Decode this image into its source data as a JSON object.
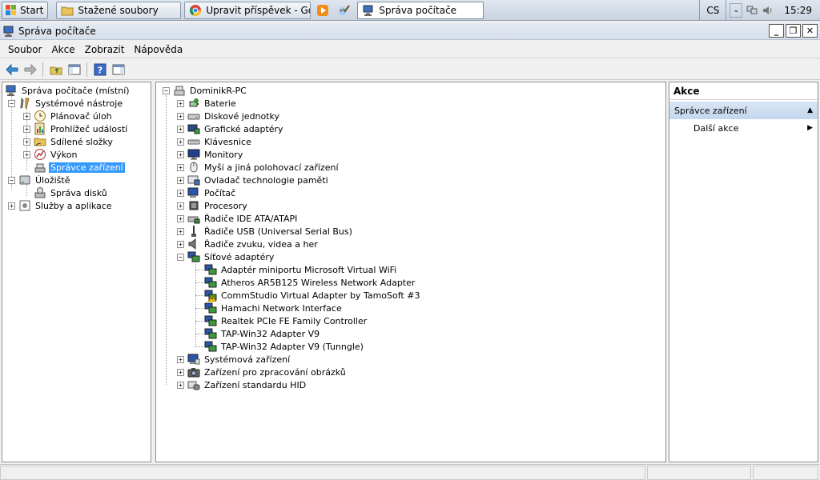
{
  "taskbar": {
    "start_label": "Start",
    "buttons": [
      {
        "label": "Stažené soubory",
        "icon": "folder-icon"
      },
      {
        "label": "Upravit příspěvek - Goo...",
        "icon": "chrome-icon"
      },
      {
        "label": "Správa počítače",
        "icon": "computer-management-icon"
      }
    ],
    "language": "CS",
    "clock": "15:29"
  },
  "window": {
    "title": "Správa počítače",
    "controls": {
      "minimize": "_",
      "restore": "❐",
      "close": "✕"
    }
  },
  "menu": [
    "Soubor",
    "Akce",
    "Zobrazit",
    "Nápověda"
  ],
  "left_tree": [
    {
      "label": "Správa počítače (místní)",
      "icon": "computer-management-icon"
    },
    {
      "label": "Systémové nástroje",
      "icon": "tools-icon",
      "expander": "−"
    },
    {
      "label": "Plánovač úloh",
      "icon": "clock-icon",
      "expander": "+"
    },
    {
      "label": "Prohlížeč událostí",
      "icon": "event-viewer-icon",
      "expander": "+"
    },
    {
      "label": "Sdílené složky",
      "icon": "shared-folder-icon",
      "expander": "+"
    },
    {
      "label": "Výkon",
      "icon": "performance-icon",
      "expander": "+"
    },
    {
      "label": "Správce zařízení",
      "icon": "device-manager-icon",
      "selected": true
    },
    {
      "label": "Úložiště",
      "icon": "storage-icon",
      "expander": "−"
    },
    {
      "label": "Správa disků",
      "icon": "disk-management-icon"
    },
    {
      "label": "Služby a aplikace",
      "icon": "services-icon",
      "expander": "+"
    }
  ],
  "device_tree": {
    "root": "DominikR-PC",
    "root_expander": "−",
    "categories": [
      {
        "label": "Baterie",
        "icon": "battery-icon",
        "expander": "+"
      },
      {
        "label": "Diskové jednotky",
        "icon": "disk-drive-icon",
        "expander": "+"
      },
      {
        "label": "Grafické adaptéry",
        "icon": "display-adapter-icon",
        "expander": "+"
      },
      {
        "label": "Klávesnice",
        "icon": "keyboard-icon",
        "expander": "+"
      },
      {
        "label": "Monitory",
        "icon": "monitor-icon",
        "expander": "+"
      },
      {
        "label": "Myši a jiná polohovací zařízení",
        "icon": "mouse-icon",
        "expander": "+"
      },
      {
        "label": "Ovladač technologie paměti",
        "icon": "memory-controller-icon",
        "expander": "+"
      },
      {
        "label": "Počítač",
        "icon": "computer-icon",
        "expander": "+"
      },
      {
        "label": "Procesory",
        "icon": "processor-icon",
        "expander": "+"
      },
      {
        "label": "Řadiče IDE ATA/ATAPI",
        "icon": "ide-controller-icon",
        "expander": "+"
      },
      {
        "label": "Řadiče USB (Universal Serial Bus)",
        "icon": "usb-icon",
        "expander": "+"
      },
      {
        "label": "Řadiče zvuku, videa a her",
        "icon": "speaker-icon",
        "expander": "+"
      },
      {
        "label": "Síťové adaptéry",
        "icon": "network-adapter-icon",
        "expander": "−"
      }
    ],
    "network_adapters": [
      {
        "label": "Adaptér miniportu Microsoft Virtual WiFi",
        "warning": false
      },
      {
        "label": "Atheros AR5B125 Wireless Network Adapter",
        "warning": false
      },
      {
        "label": "CommStudio Virtual Adapter by TamoSoft #3",
        "warning": true
      },
      {
        "label": "Hamachi Network Interface",
        "warning": false
      },
      {
        "label": "Realtek PCIe FE Family Controller",
        "warning": false
      },
      {
        "label": "TAP-Win32 Adapter V9",
        "warning": false
      },
      {
        "label": "TAP-Win32 Adapter V9 (Tunngle)",
        "warning": false
      }
    ],
    "categories_after": [
      {
        "label": "Systémová zařízení",
        "icon": "system-devices-icon",
        "expander": "+"
      },
      {
        "label": "Zařízení pro zpracování obrázků",
        "icon": "camera-icon",
        "expander": "+"
      },
      {
        "label": "Zařízení standardu HID",
        "icon": "hid-icon",
        "expander": "+"
      }
    ]
  },
  "actions": {
    "header": "Akce",
    "section": "Správce zařízení",
    "items": [
      "Další akce"
    ]
  }
}
